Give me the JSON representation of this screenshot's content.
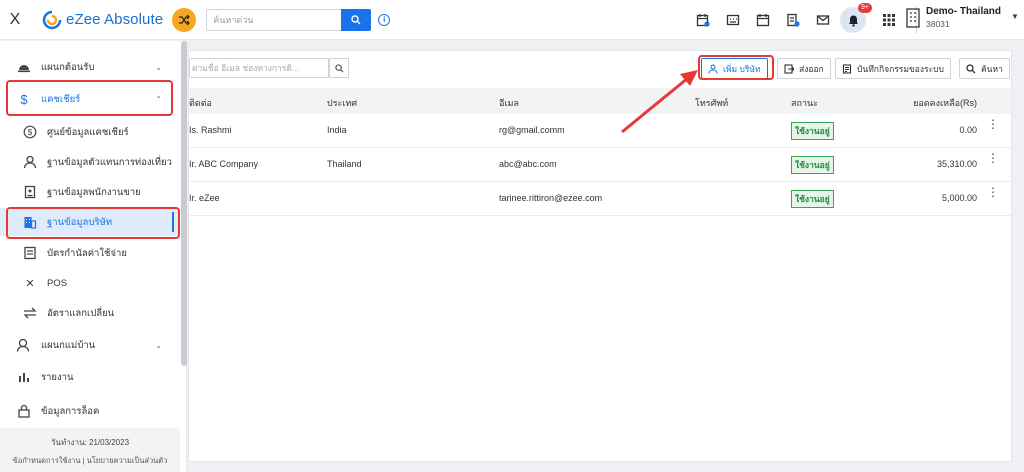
{
  "topbar": {
    "close_label": "X",
    "logo_text": "eZee Absolute",
    "search_placeholder": "ค้นหาด่วน",
    "notification_count": "9+",
    "property_name": "Demo- Thailand",
    "property_id": "38031"
  },
  "sidebar": {
    "items": [
      {
        "label": "แผนกต้อนรับ",
        "icon": "bell-desk-icon"
      },
      {
        "label": "แคชเชียร์",
        "icon": "dollar-icon"
      },
      {
        "label": "ศูนย์ข้อมูลแคชเชียร์",
        "icon": "dollar-circle-icon"
      },
      {
        "label": "ฐานข้อมูลตัวแทนการท่องเที่ยว",
        "icon": "person-icon"
      },
      {
        "label": "ฐานข้อมูลพนักงานขาย",
        "icon": "badge-icon"
      },
      {
        "label": "ฐานข้อมูลบริษัท",
        "icon": "building-icon"
      },
      {
        "label": "บัตรกำนัลค่าใช้จ่าย",
        "icon": "card-icon"
      },
      {
        "label": "POS",
        "icon": "pos-icon"
      },
      {
        "label": "อัตราแลกเปลี่ยน",
        "icon": "exchange-icon"
      },
      {
        "label": "แผนกแม่บ้าน",
        "icon": "housekeeping-icon"
      },
      {
        "label": "รายงาน",
        "icon": "report-icon"
      },
      {
        "label": "ข้อมูลการล็อค",
        "icon": "lock-icon"
      }
    ],
    "footer": {
      "work_date": "วันทำงาน: 21/03/2023",
      "terms": "ข้อกำหนดการใช้งาน",
      "privacy": "นโยบายความเป็นส่วนตัว"
    }
  },
  "toolbar": {
    "filter_placeholder": "ตามชื่อ อีเมล ช่องทางการติ...",
    "add_company": "เพิ่ม บริษัท",
    "export": "ส่งออก",
    "audit_log": "บันทึกกิจกรรมของระบบ",
    "search": "ค้นหา"
  },
  "table": {
    "headers": [
      "ติดต่อ",
      "ประเทศ",
      "อีเมล",
      "โทรศัพท์",
      "สถานะ",
      "ยอดคงเหลือ(Rs)"
    ],
    "rows": [
      {
        "contact": "Is. Rashmi",
        "country": "India",
        "email": "rg@gmail.comm",
        "phone": "",
        "status": "ใช้งานอยู่",
        "balance": "0.00"
      },
      {
        "contact": "Ir. ABC Company",
        "country": "Thailand",
        "email": "abc@abc.com",
        "phone": "",
        "status": "ใช้งานอยู่",
        "balance": "35,310.00"
      },
      {
        "contact": "Ir. eZee",
        "country": "",
        "email": "tarinee.rittiron@ezee.com",
        "phone": "",
        "status": "ใช้งานอยู่",
        "balance": "5,000.00"
      }
    ]
  },
  "colors": {
    "accent": "#1a73e8",
    "highlight": "#e53935",
    "status_green": "#1e8e3e",
    "shuffle_orange": "#f5a623"
  }
}
